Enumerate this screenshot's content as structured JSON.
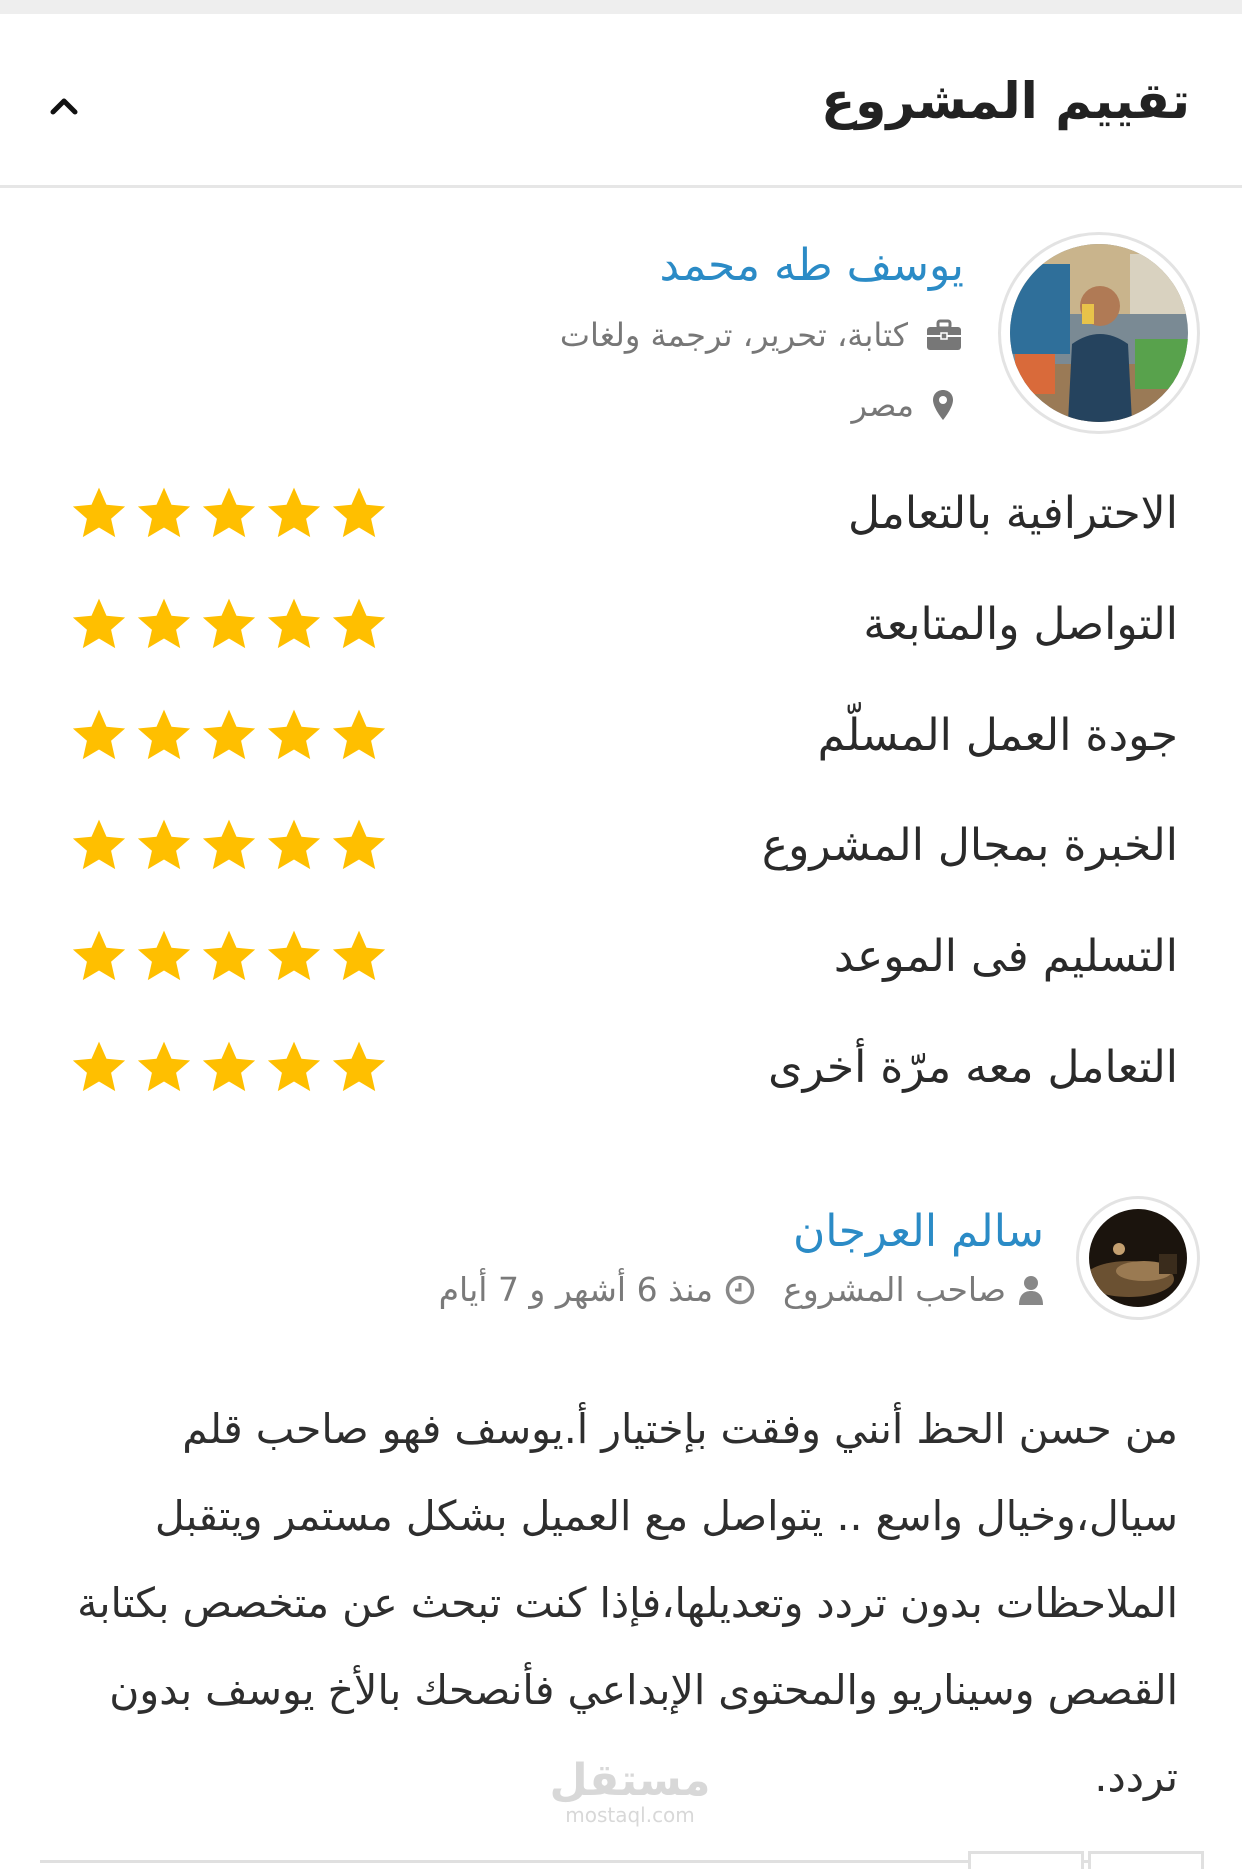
{
  "header": {
    "title": "تقييم المشروع"
  },
  "freelancer": {
    "name": "يوسف طه محمد",
    "skills": "كتابة، تحرير، ترجمة ولغات",
    "country": "مصر"
  },
  "ratings": [
    {
      "label": "الاحترافية بالتعامل",
      "stars": 5
    },
    {
      "label": "التواصل والمتابعة",
      "stars": 5
    },
    {
      "label": "جودة العمل المسلّم",
      "stars": 5
    },
    {
      "label": "الخبرة بمجال المشروع",
      "stars": 5
    },
    {
      "label": "التسليم فى الموعد",
      "stars": 5
    },
    {
      "label": "التعامل معه مرّة أخرى",
      "stars": 5
    }
  ],
  "review": {
    "author": "سالم العرجان",
    "role": "صاحب المشروع",
    "time": "منذ 6 أشهر و 7 أيام",
    "text": "من حسن الحظ أنني وفقت بإختيار أ.يوسف فهو صاحب قلم سيال،وخيال واسع .. يتواصل مع العميل بشكل مستمر ويتقبل الملاحظات بدون تردد وتعديلها،فإذا كنت تبحث عن متخصص بكتابة القصص وسيناريو والمحتوى الإبداعي فأنصحك بالأخ يوسف بدون تردد."
  },
  "watermark": {
    "arabic": "مستقل",
    "latin": "mostaql.com"
  },
  "colors": {
    "link": "#2b8bc6",
    "star": "#ffbf00",
    "muted": "#777777"
  },
  "icons": {
    "collapse": "chevron-up-icon",
    "skills": "briefcase-icon",
    "country": "map-marker-icon",
    "role": "user-icon",
    "time": "clock-icon",
    "rating": "star-icon"
  }
}
